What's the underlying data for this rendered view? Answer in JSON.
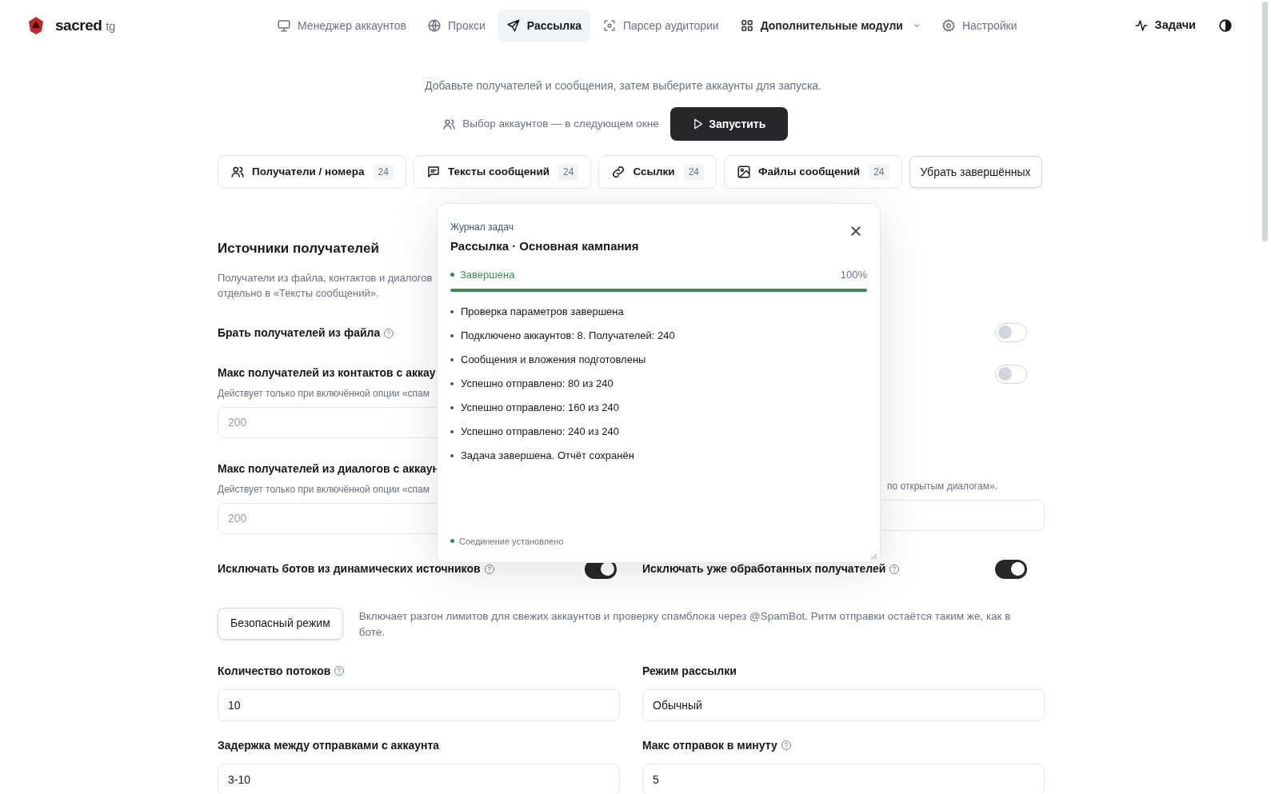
{
  "logo": {
    "name": "sacred",
    "suffix": "tg"
  },
  "nav": [
    {
      "label": "Менеджер аккаунтов",
      "kind": "link",
      "selected": false
    },
    {
      "label": "Прокси",
      "kind": "link",
      "selected": false
    },
    {
      "label": "Рассылка",
      "kind": "link",
      "selected": true
    },
    {
      "label": "Парсер аудитории",
      "kind": "link",
      "selected": false
    },
    {
      "label": "Дополнительные модули",
      "kind": "dropdown",
      "selected": false
    },
    {
      "label": "Настройки",
      "kind": "link",
      "selected": false
    }
  ],
  "tasks_button": "Задачи",
  "intro": "Добавьте получателей и сообщения, затем выберите аккаунты для запуска.",
  "accounts_hint": "Выбор аккаунтов — в следующем окне",
  "launch_button": "Запустить",
  "chips": [
    {
      "label": "Получатели / номера",
      "count": "24"
    },
    {
      "label": "Тексты сообщений",
      "count": "24"
    },
    {
      "label": "Ссылки",
      "count": "24"
    },
    {
      "label": "Файлы сообщений",
      "count": "24"
    }
  ],
  "clear_button": "Убрать завершённых",
  "section": {
    "title": "Источники получателей",
    "description": [
      "Получатели из файла, контактов и диалогов",
      "отдельно в «Тексты сообщений»."
    ]
  },
  "file_row": {
    "label": "Брать получателей из файла",
    "help": true,
    "right_toggle_on": false
  },
  "contacts_row": {
    "label": "Макс получателей из контактов с аккау",
    "hint": "Действует только при включённой опции «спам",
    "placeholder": "200",
    "right_toggle_on": false
  },
  "dialogs_row": {
    "label": "Макс получателей из диалогов с аккаун",
    "hint": "Действует только при включённой опции «спам",
    "placeholder": "200",
    "right_hint": "по открытым диалогам»."
  },
  "exclude": [
    {
      "label": "Исключать ботов из динамических источников",
      "help": true,
      "on": true
    },
    {
      "label": "Исключать уже обработанных получателей",
      "help": true,
      "on": true
    }
  ],
  "safe_mode": {
    "button": "Безопасный режим",
    "description": "Включает разгон лимитов для свежих аккаунтов и проверку спамблока через @SpamBot. Ритм отправки остаётся таким же, как в боте."
  },
  "settings": [
    {
      "label": "Количество потоков",
      "help": true,
      "value": "10"
    },
    {
      "label": "Режим рассылки",
      "help": false,
      "value": "Обычный"
    },
    {
      "label": "Задержка между отправками с аккаунта",
      "help": false,
      "value": "3-10"
    },
    {
      "label": "Макс отправок в минуту",
      "help": true,
      "value": "5"
    }
  ],
  "task_log": {
    "eyebrow": "Журнал задач",
    "title": "Рассылка · Основная кампания",
    "status": "Завершена",
    "percent": "100%",
    "level": 1,
    "entries": [
      "Проверка параметров завершена",
      "Подключено аккаунтов: 8. Получателей: 240",
      "Сообщения и вложения подготовлены",
      "Успешно отправлено: 80 из 240",
      "Успешно отправлено: 160 из 240",
      "Успешно отправлено: 240 из 240",
      "Задача завершена. Отчёт сохранён"
    ],
    "connection": "Соединение установлено"
  }
}
